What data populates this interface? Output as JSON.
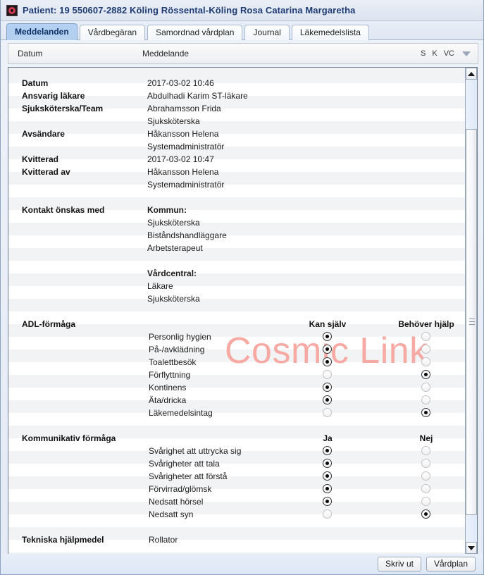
{
  "window": {
    "icon": "patient-record-icon",
    "title": "Patient: 19 550607-2882 Köling Rössental-Köling Rosa Catarina Margaretha"
  },
  "tabs": [
    {
      "label": "Meddelanden",
      "active": true
    },
    {
      "label": "Vårdbegäran",
      "active": false
    },
    {
      "label": "Samordnad vårdplan",
      "active": false
    },
    {
      "label": "Journal",
      "active": false
    },
    {
      "label": "Läkemedelslista",
      "active": false
    }
  ],
  "list_header": {
    "datum": "Datum",
    "meddelande": "Meddelande",
    "flag_s": "S",
    "flag_k": "K",
    "flag_vc": "VC",
    "menu_icon": "chevron-down-icon"
  },
  "watermark": "Cosmic Link",
  "detail": {
    "fields": [
      {
        "label": "Datum",
        "values": [
          "2017-03-02 10:46"
        ]
      },
      {
        "label": "Ansvarig läkare",
        "values": [
          "Abdulhadi Karim ST-läkare"
        ]
      },
      {
        "label": "Sjuksköterska/Team",
        "values": [
          "Abrahamsson Frida",
          "Sjuksköterska"
        ]
      },
      {
        "label": "Avsändare",
        "values": [
          "Håkansson Helena",
          "Systemadministratör"
        ]
      },
      {
        "label": "Kvitterad",
        "values": [
          "2017-03-02 10:47"
        ]
      },
      {
        "label": "Kvitterad av",
        "values": [
          "Håkansson Helena",
          "Systemadministratör"
        ]
      }
    ],
    "kontakt": {
      "label": "Kontakt önskas med",
      "groups": [
        {
          "heading": "Kommun:",
          "items": [
            "Sjuksköterska",
            "Biståndshandläggare",
            "Arbetsterapeut"
          ]
        },
        {
          "heading": "Vårdcentral:",
          "items": [
            "Läkare",
            "Sjuksköterska"
          ]
        }
      ]
    },
    "adl": {
      "label": "ADL-förmåga",
      "col1": "Kan själv",
      "col2": "Behöver hjälp",
      "items": [
        {
          "label": "Personlig hygien",
          "selected": 1
        },
        {
          "label": "På-/avklädning",
          "selected": 1
        },
        {
          "label": "Toalettbesök",
          "selected": 1
        },
        {
          "label": "Förflyttning",
          "selected": 2
        },
        {
          "label": "Kontinens",
          "selected": 1
        },
        {
          "label": "Äta/dricka",
          "selected": 1
        },
        {
          "label": "Läkemedelsintag",
          "selected": 2
        }
      ]
    },
    "kommunikativ": {
      "label": "Kommunikativ förmåga",
      "col1": "Ja",
      "col2": "Nej",
      "items": [
        {
          "label": "Svårighet att uttrycka sig",
          "selected": 1
        },
        {
          "label": "Svårigheter att tala",
          "selected": 1
        },
        {
          "label": "Svårigheter att förstå",
          "selected": 1
        },
        {
          "label": "Förvirrad/glömsk",
          "selected": 1
        },
        {
          "label": "Nedsatt hörsel",
          "selected": 1
        },
        {
          "label": "Nedsatt syn",
          "selected": 2
        }
      ]
    },
    "hjalpmedel": {
      "label": "Tekniska hjälpmedel",
      "value": "Rollator"
    }
  },
  "footer": {
    "print_label": "Skriv ut",
    "careplan_label": "Vårdplan"
  }
}
